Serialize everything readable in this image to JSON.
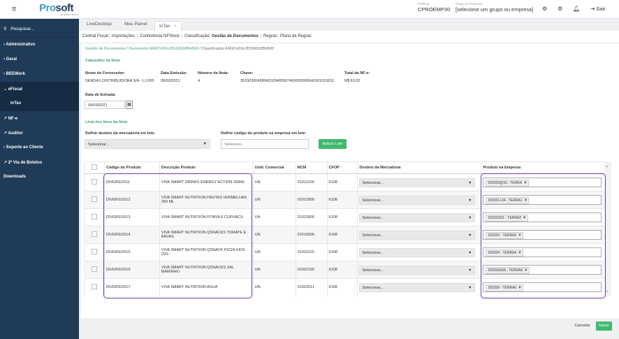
{
  "topbar": {
    "menu_icon": "hamburger-icon",
    "logo_pro": "Pro",
    "logo_soft": "soft",
    "logo_sub": "by wolters kluwer",
    "env_label": "ProEmp",
    "env_value": "CPROEMP30",
    "group_label": "Grupo ou Empresa",
    "group_value": "[selecione um grupo ou empresa]",
    "exit_label": "Sair",
    "icons": [
      "gear-icon",
      "settings-icon",
      "bell-icon",
      "exit-icon"
    ]
  },
  "sidebar": {
    "search_label": "Pesquisar...",
    "items": [
      {
        "label": "Administrativo",
        "prefix": "›"
      },
      {
        "label": "Geral",
        "prefix": "›"
      },
      {
        "label": "BEEWork",
        "prefix": "›"
      },
      {
        "label": "eFiscal",
        "prefix": "⌄"
      },
      {
        "label": "InTax",
        "prefix": ""
      },
      {
        "label": "NF-e",
        "prefix": "↗"
      },
      {
        "label": "Auditor",
        "prefix": "↗"
      },
      {
        "label": "Suporte ao Cliente",
        "prefix": "›"
      },
      {
        "label": "2ª Via de Boletos",
        "prefix": "↗"
      },
      {
        "label": "Downloads",
        "prefix": ""
      }
    ]
  },
  "tabs": {
    "items": [
      "LiveDesktop",
      "Meu Painel",
      "InTax"
    ],
    "close": "×"
  },
  "subnav": {
    "items": [
      "Central Fiscal",
      "Importações",
      "Conferência NFStock",
      "Classificação",
      "Gestão de Documentos",
      "Regras",
      "Plano de Regras"
    ],
    "separator": "|"
  },
  "breadcrumb": {
    "part1": "Gestão de Documentos",
    "part2": "Documento 842d7e53ccf8150018f54500",
    "current": "Classificação 842d7e53ccf8150018f54500",
    "separator": "/"
  },
  "header": {
    "section_title": "Cabeçalho da Nota",
    "fornecedor_label": "Nome do Fornecedor:",
    "fornecedor_value": "SENDAS DISTRIBUIDORA S/A - LJ 005",
    "emissao_label": "Data Emissão:",
    "emissao_value": "09/03/2021",
    "numero_label": "Número da Nota:",
    "numero_value": "4",
    "chave_label": "Chave:",
    "chave_value": "35190300438042029405507400000000041001010011",
    "total_label": "Total da NF-e:",
    "total_value": "R$ 63,02",
    "entrada_label": "Data de Entrada:",
    "entrada_value": "09/03/2021",
    "calendar_icon": "calendar-icon"
  },
  "items_section": {
    "title": "Lista dos Itens da Nota",
    "destino_label": "Definir destino da mercadoria em lote:",
    "destino_placeholder": "Selecionar...",
    "codigo_label": "Definir código do produto na empresa em lote:",
    "codigo_placeholder": "Selecione...",
    "apply_button": "Aplicar Lote"
  },
  "table": {
    "columns": [
      "",
      "Código do Produto",
      "Descrição Produto",
      "Unid. Comercial",
      "NCM",
      "CFOP ↑",
      "Destino da Mercadoria",
      "Produto na Empresa"
    ],
    "select_placeholder": "Selecionar...",
    "rows": [
      {
        "code": "DIVERSOS11",
        "desc": "VIVA SMART DRINKS ENERGY ACTION 269ML",
        "unit": "UN",
        "ncm": "01012100",
        "cfop": "6108",
        "prod": "200200@33 - TERRA"
      },
      {
        "code": "DIVERSOS12",
        "desc": "VIVA SMART NUTRITION FRUTAS VERMELHAS 269 ML",
        "unit": "UN",
        "ncm": "01012900",
        "cfop": "6108",
        "prod": "200201+34 - TERRA1"
      },
      {
        "code": "DIVERSOS13",
        "desc": "VIVA SMART NUTRITION PITAYA E CUPUACU",
        "unit": "UN",
        "ncm": "01013000",
        "cfop": "6108",
        "prod": "200202/01 - TERRA2"
      },
      {
        "code": "DIVERSOS14",
        "desc": "VIVA SMART NUTRITION QSNACKS TOMATE E ERVAS",
        "unit": "UN",
        "ncm": "01019000",
        "cfop": "6108",
        "prod": "200203 - TERRA3"
      },
      {
        "code": "DIVERSOS15",
        "desc": "VIVA SMART NUTRITION QSNACK PIZZA KIDS 22G",
        "unit": "UN",
        "ncm": "01022110",
        "cfop": "6108",
        "prod": "200204 - TERRA4"
      },
      {
        "code": "DIVERSOS16",
        "desc": "VIVA SMART NUTRITION QSNACKS SAL MARINHO",
        "unit": "UN",
        "ncm": "01022190",
        "cfop": "6108",
        "prod": "200205A28 - TERRA5"
      },
      {
        "code": "DIVERSOS17",
        "desc": "VIVA SMART NUTRITION AGUA",
        "unit": "UN",
        "ncm": "01022911",
        "cfop": "6108",
        "prod": "200206 - TERRA6"
      }
    ]
  },
  "footer": {
    "cancel": "Cancelar",
    "save": "Salvar"
  },
  "colors": {
    "sidebar": "#1f3b57",
    "accent_green": "#3fb96e",
    "link_teal": "#3f9c87",
    "highlight_purple": "#6a3aa8"
  }
}
